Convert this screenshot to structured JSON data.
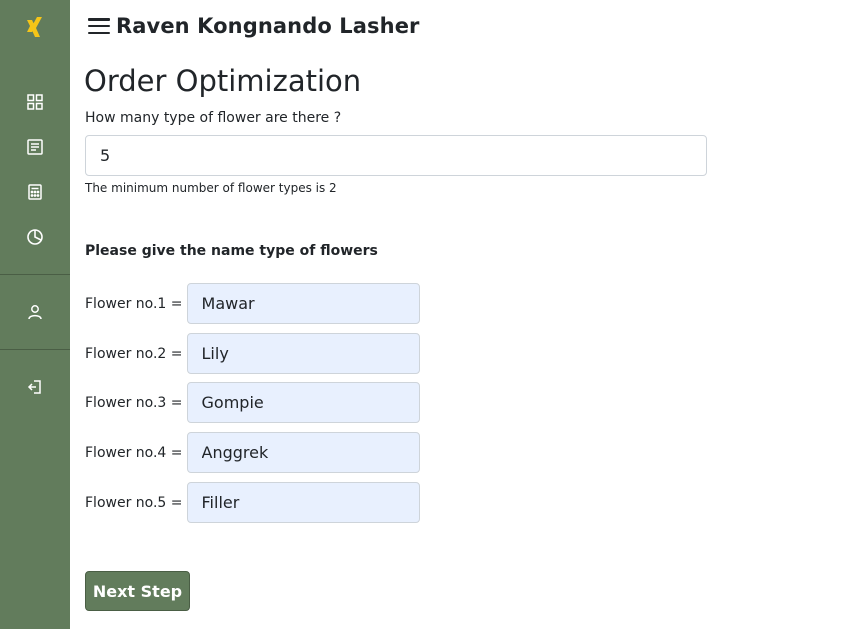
{
  "header": {
    "title": "Raven Kongnando Lasher"
  },
  "page": {
    "title": "Order Optimization",
    "question": "How many type of flower are there ?",
    "count_value": "5",
    "hint": "The minimum number of flower types is 2",
    "section_heading": "Please give the name type of flowers"
  },
  "flowers": [
    {
      "label": "Flower no.1 =",
      "value": "Mawar"
    },
    {
      "label": "Flower no.2 =",
      "value": "Lily"
    },
    {
      "label": "Flower no.3 =",
      "value": "Gompie"
    },
    {
      "label": "Flower no.4 =",
      "value": "Anggrek"
    },
    {
      "label": "Flower no.5 =",
      "value": "Filler"
    }
  ],
  "actions": {
    "next_label": "Next Step"
  },
  "sidebar": {
    "icons": [
      "logo-icon",
      "dashboard-icon",
      "list-icon",
      "calculator-icon",
      "pie-chart-icon",
      "user-icon",
      "logout-icon"
    ]
  },
  "colors": {
    "sidebar": "#627c5c",
    "logo": "#f5c518",
    "input_filled": "#e8f0fe",
    "button": "#627c5c"
  }
}
